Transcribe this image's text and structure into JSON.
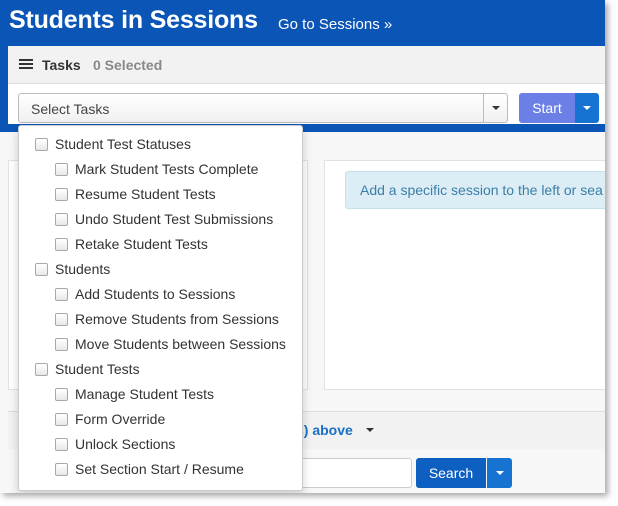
{
  "header": {
    "title": "Students in Sessions",
    "go_to_sessions": "Go to Sessions »"
  },
  "tasks": {
    "label": "Tasks",
    "selected_count": "0 Selected",
    "select_value": "Select Tasks",
    "start_label": "Start"
  },
  "dropdown": {
    "groups": [
      {
        "label": "Student Test Statuses",
        "items": [
          "Mark Student Tests Complete",
          "Resume Student Tests",
          "Undo Student Test Submissions",
          "Retake Student Tests"
        ]
      },
      {
        "label": "Students",
        "items": [
          "Add Students to Sessions",
          "Remove Students from Sessions",
          "Move Students between Sessions"
        ]
      },
      {
        "label": "Student Tests",
        "items": [
          "Manage Student Tests",
          "Form Override",
          "Unlock Sections",
          "Set Section Start / Resume"
        ]
      }
    ]
  },
  "main": {
    "info_text": "Add a specific session to the left or sea",
    "above_link": "s) above",
    "search_label": "Search"
  },
  "colors": {
    "header_blue": "#0a55b6",
    "start_button": "#6b7fe6",
    "search_button": "#0e5fc2",
    "info_bg": "#dcedf5"
  }
}
